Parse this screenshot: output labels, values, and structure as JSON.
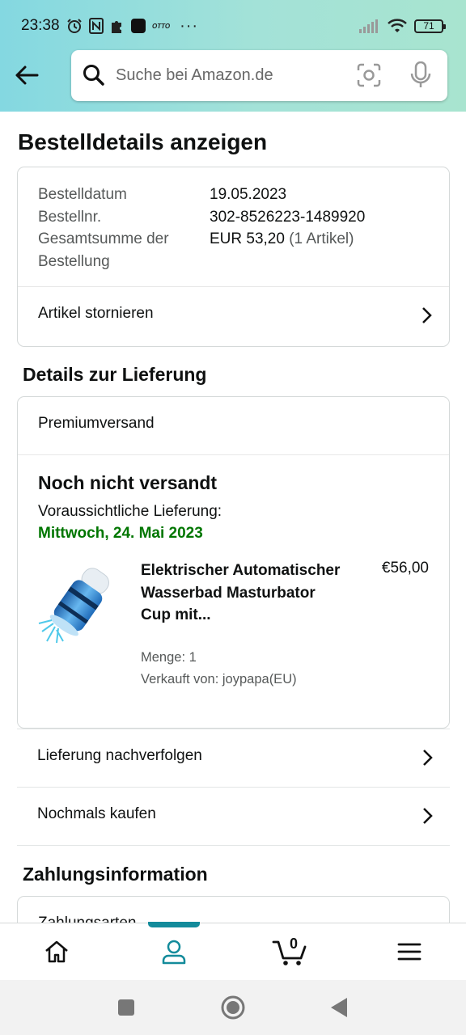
{
  "status_bar": {
    "time": "23:38",
    "battery": "71",
    "app_icons": [
      "alarm-icon",
      "nfc-icon",
      "puzzle-icon",
      "app-square-icon",
      "otto-icon"
    ],
    "otto_label": "OTTO",
    "more": "···"
  },
  "header": {
    "search_placeholder": "Suche bei Amazon.de"
  },
  "page": {
    "title": "Bestelldetails anzeigen"
  },
  "order_summary": {
    "date_label": "Bestelldatum",
    "date_value": "19.05.2023",
    "number_label": "Bestellnr.",
    "number_value": "302-8526223-1489920",
    "total_label": "Gesamtsumme der Bestellung",
    "total_value": "EUR 53,20",
    "total_items": "(1 Artikel)",
    "cancel_link": "Artikel stornieren"
  },
  "delivery": {
    "section_title": "Details zur Lieferung",
    "shipping_type": "Premiumversand",
    "status": "Noch nicht versandt",
    "eta_label": "Voraussichtliche Lieferung:",
    "eta_date": "Mittwoch, 24. Mai 2023",
    "product": {
      "title": "Elektrischer Automatischer Wasserbad Masturbator Cup mit...",
      "price": "€56,00",
      "quantity": "Menge: 1",
      "seller": "Verkauft von: joypapa(EU)"
    }
  },
  "actions": {
    "track": "Lieferung nachverfolgen",
    "buy_again": "Nochmals kaufen"
  },
  "payment": {
    "section_title": "Zahlungsinformation",
    "peek_text": "Zahlungsarten"
  },
  "bottom_nav": {
    "cart_count": "0"
  },
  "colors": {
    "header_gradient_start": "#84d8e1",
    "header_gradient_end": "#a8e4cf",
    "delivery_green": "#007600",
    "active_tab": "#138b9b"
  }
}
